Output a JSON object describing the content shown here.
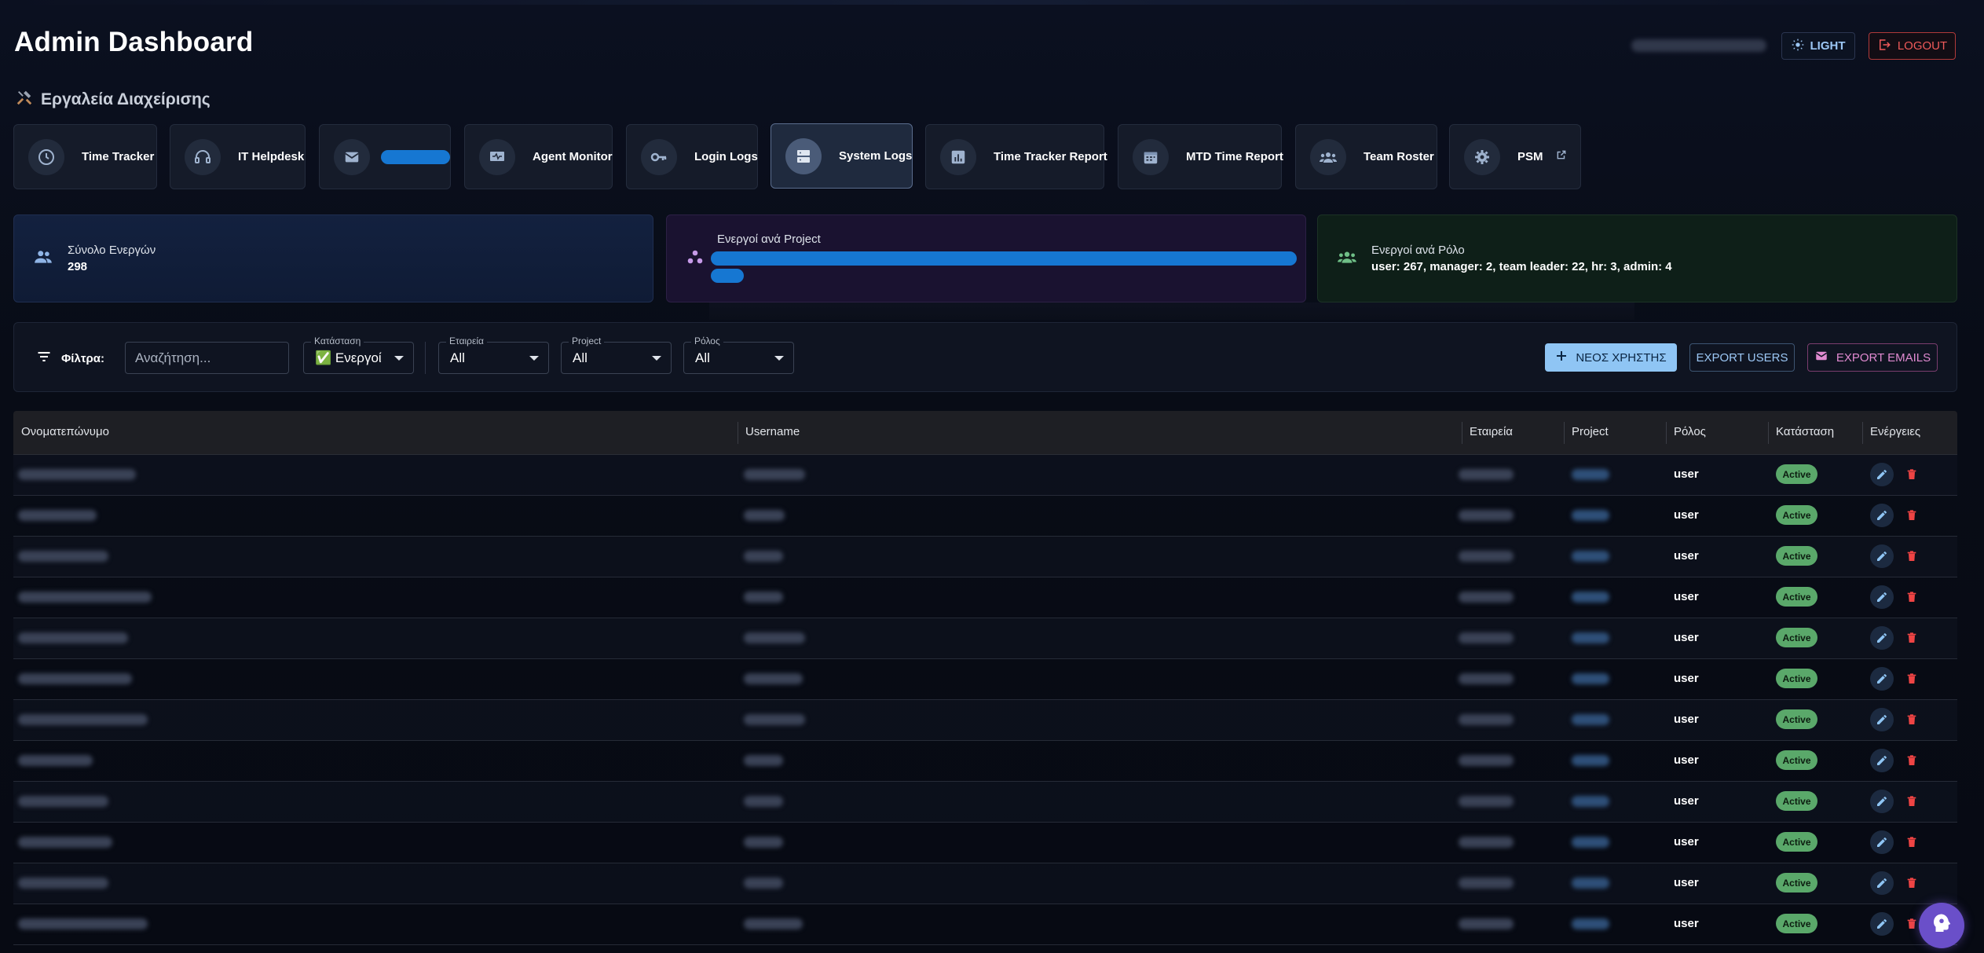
{
  "header": {
    "title": "Admin Dashboard",
    "light_label": "LIGHT",
    "logout_label": "LOGOUT"
  },
  "tools": {
    "title": "Εργαλεία Διαχείρισης",
    "items": [
      {
        "label": "Time Tracker",
        "icon": "clock-icon"
      },
      {
        "label": "IT Helpdesk",
        "icon": "headset-icon"
      },
      {
        "label": "",
        "icon": "mail-icon"
      },
      {
        "label": "Agent Monitor",
        "icon": "monitor-icon"
      },
      {
        "label": "Login Logs",
        "icon": "key-icon"
      },
      {
        "label": "System Logs",
        "icon": "storage-icon"
      },
      {
        "label": "Time Tracker Report",
        "icon": "report-icon"
      },
      {
        "label": "MTD Time Report",
        "icon": "calendar-icon"
      },
      {
        "label": "Team Roster",
        "icon": "group-icon"
      },
      {
        "label": "PSM",
        "icon": "gear-icon"
      }
    ]
  },
  "stats": {
    "total_label": "Σύνολο Ενεργών",
    "total_value": "298",
    "project_label": "Ενεργοί ανά Project",
    "role_label": "Ενεργοί ανά Ρόλο",
    "role_value": "user: 267, manager: 2, team leader: 22, hr: 3, admin: 4"
  },
  "filters": {
    "label": "Φίλτρα:",
    "search_placeholder": "Αναζήτηση...",
    "status": {
      "label": "Κατάσταση",
      "value": "✅ Ενεργοί"
    },
    "company": {
      "label": "Εταιρεία",
      "value": "All"
    },
    "project": {
      "label": "Project",
      "value": "All"
    },
    "role": {
      "label": "Ρόλος",
      "value": "All"
    },
    "new_user_label": "ΝΕΟΣ ΧΡΗΣΤΗΣ",
    "export_users_label": "EXPORT USERS",
    "export_emails_label": "EXPORT EMAILS"
  },
  "table": {
    "columns": [
      "Ονοματεπώνυμο",
      "Username",
      "Εταιρεία",
      "Project",
      "Ρόλος",
      "Κατάσταση",
      "Ενέργειες"
    ],
    "rows": [
      {
        "role": "user",
        "status": "Active"
      },
      {
        "role": "user",
        "status": "Active"
      },
      {
        "role": "user",
        "status": "Active"
      },
      {
        "role": "user",
        "status": "Active"
      },
      {
        "role": "user",
        "status": "Active"
      },
      {
        "role": "user",
        "status": "Active"
      },
      {
        "role": "user",
        "status": "Active"
      },
      {
        "role": "user",
        "status": "Active"
      },
      {
        "role": "user",
        "status": "Active"
      },
      {
        "role": "user",
        "status": "Active"
      },
      {
        "role": "user",
        "status": "Active"
      },
      {
        "role": "user",
        "status": "Active"
      }
    ]
  },
  "colors": {
    "accent": "#1677d2",
    "active_badge": "#5aa86a",
    "danger": "#ef4444",
    "fab": "#6a4fc9"
  }
}
